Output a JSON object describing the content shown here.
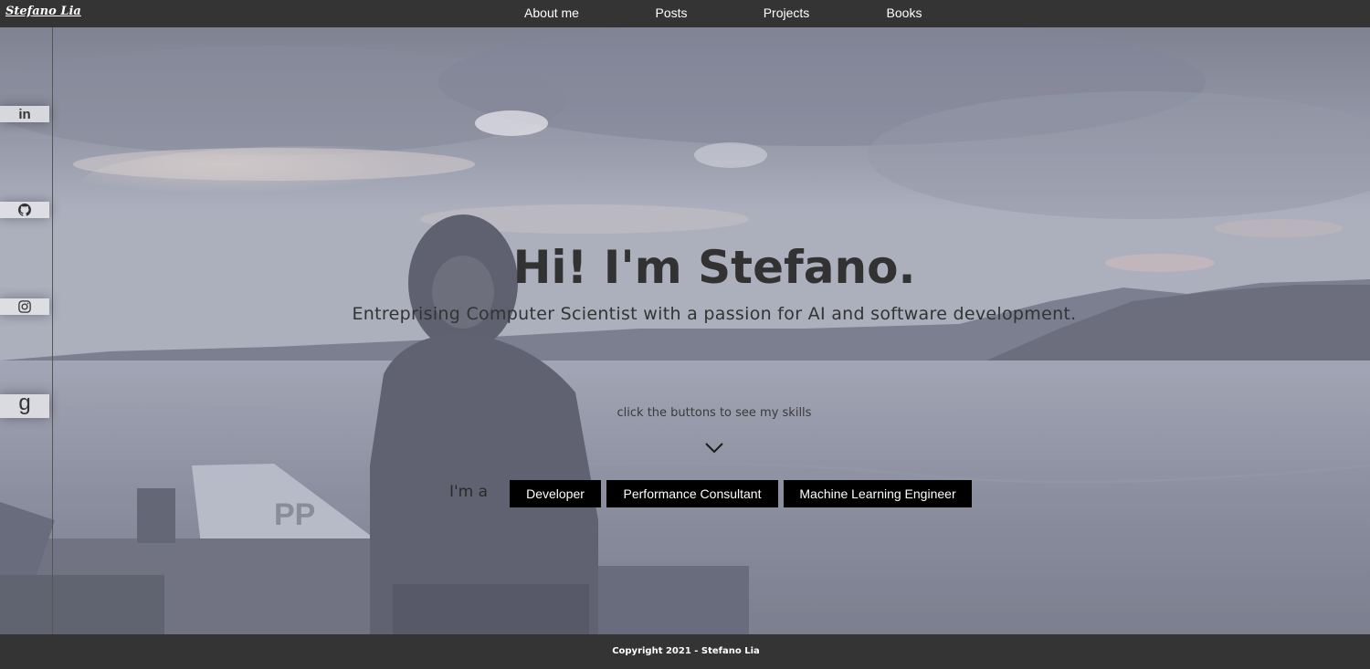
{
  "brand": "Stefano Lia",
  "nav": {
    "about": "About me",
    "posts": "Posts",
    "projects": "Projects",
    "books": "Books"
  },
  "social": {
    "linkedin": "in",
    "goodreads": "g"
  },
  "hero": {
    "headline": "Hi! I'm Stefano.",
    "subtitle": "Entreprising Computer Scientist with a passion for AI and software development.",
    "hint": "click the buttons to see my skills",
    "ima": "I'm a"
  },
  "skills": {
    "developer": "Developer",
    "consultant": "Performance Consultant",
    "ml": "Machine Learning Engineer"
  },
  "footer": {
    "copyright": "Copyright 2021 - Stefano Lia"
  },
  "colors": {
    "bar": "#343434",
    "button_bg": "#000000",
    "button_text": "#ffffff",
    "headline": "#323232"
  }
}
